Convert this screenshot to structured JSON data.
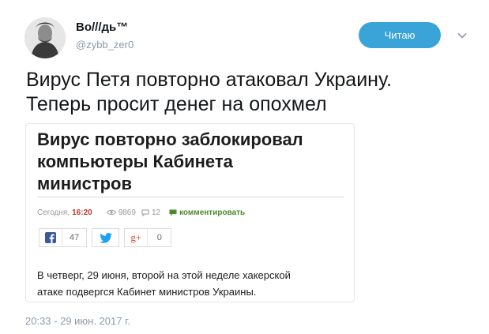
{
  "author": {
    "name": "Во///дь™",
    "handle": "@zybb_zer0"
  },
  "follow_button": {
    "label": "Читаю"
  },
  "icons": {
    "avatar": "portrait-avatar",
    "more": "chevron-down-icon",
    "views": "eye-icon",
    "comments": "comment-bubble-icon",
    "comment_link": "speech-bubble-icon",
    "share": [
      "facebook-icon",
      "twitter-icon",
      "google-plus-icon"
    ]
  },
  "tweet": {
    "lines": [
      "Вирус Петя повторно атаковал Украину.",
      "Теперь просит денег на опохмел"
    ],
    "timestamp": "20:33 - 29 июн. 2017 г."
  },
  "article": {
    "title_lines": [
      "Вирус повторно заблокировал",
      "компьютеры Кабинета",
      "министров"
    ],
    "date_label": "Сегодня,",
    "time": "16:20",
    "views": "9869",
    "comments": "12",
    "comment_link": "комментировать",
    "share": {
      "facebook_count": "47",
      "google_count": "0",
      "google_label": "g+"
    },
    "body_lines": [
      "В четверг, 29 июня, второй на этой неделе хакерской",
      "атаке подвергся Кабинет министров Украины."
    ]
  },
  "colors": {
    "accent": "#3aa3d8",
    "time": "#c0392b",
    "comment_link": "#4a8a2a",
    "facebook": "#3b5998",
    "twitter": "#1da1f2",
    "google": "#dd4b39"
  }
}
